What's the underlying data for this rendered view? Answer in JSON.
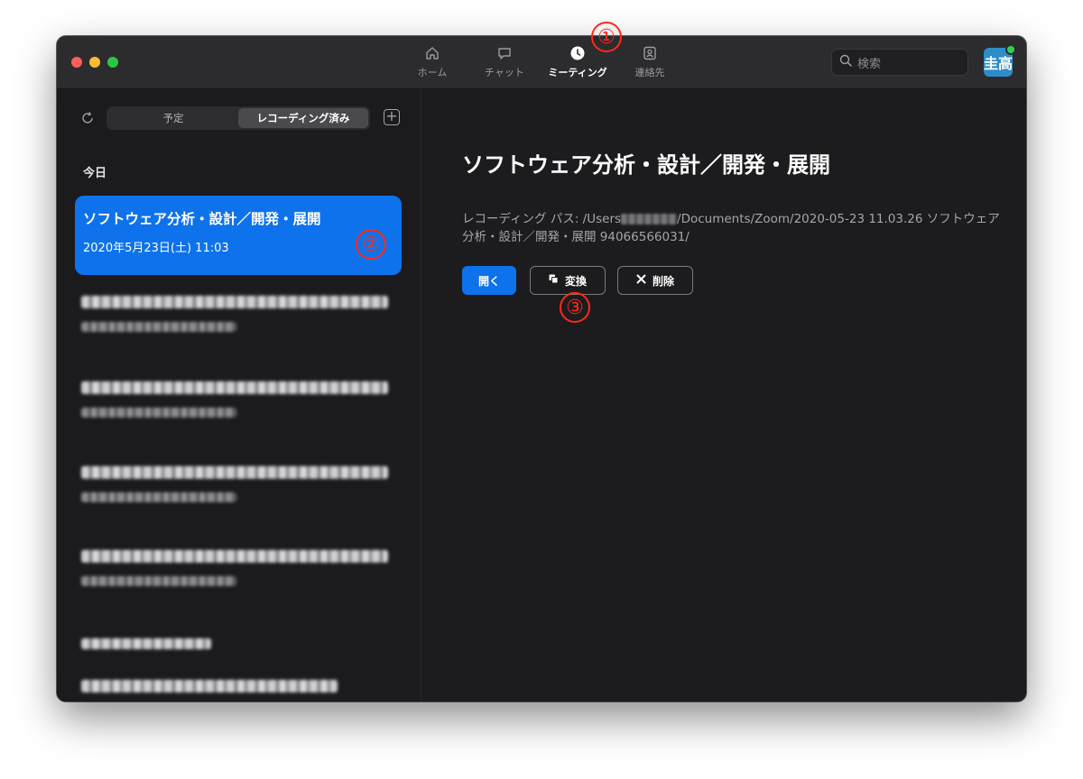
{
  "nav": {
    "tabs": [
      {
        "label": "ホーム",
        "icon": "home-icon"
      },
      {
        "label": "チャット",
        "icon": "chat-icon"
      },
      {
        "label": "ミーティング",
        "icon": "clock-icon",
        "active": true
      },
      {
        "label": "連絡先",
        "icon": "contacts-icon"
      }
    ],
    "search_placeholder": "検索",
    "avatar_text": "圭高"
  },
  "sidebar": {
    "segments": [
      "予定",
      "レコーディング済み"
    ],
    "active_segment": "レコーディング済み",
    "section_today": "今日",
    "selected_item": {
      "title": "ソフトウェア分析・設計／開発・展開",
      "datetime": "2020年5月23日(土) 11:03"
    }
  },
  "detail": {
    "title": "ソフトウェア分析・設計／開発・展開",
    "path_prefix": "レコーディング パス: /Users",
    "path_suffix": "/Documents/Zoom/2020-05-23 11.03.26 ソフトウェア分析・設計／開発・展開 94066566031/",
    "buttons": {
      "open": "開く",
      "convert": "変換",
      "delete": "削除"
    }
  },
  "annotations": [
    "①",
    "②",
    "③"
  ],
  "colors": {
    "accent": "#0e72ed",
    "marker": "#ff2a1a",
    "window_bg": "#1c1c1e"
  }
}
